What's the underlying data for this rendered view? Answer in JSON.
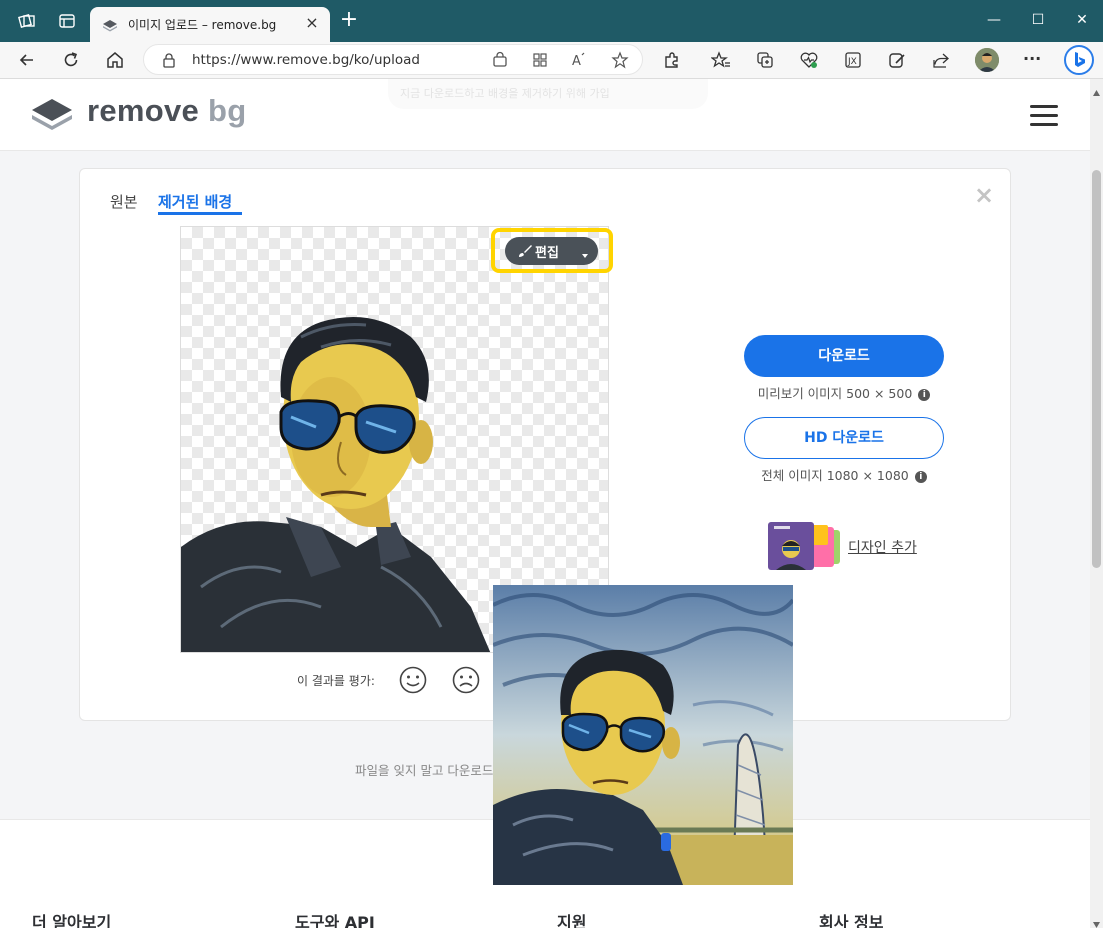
{
  "browser": {
    "tab_title": "이미지 업로드 – remove.bg",
    "tab_close": "×",
    "new_tab": "+",
    "url": "https://www.remove.bg/ko/upload",
    "window_controls": {
      "minimize": "—",
      "maximize": "☐",
      "close": "✕"
    },
    "icons": [
      "workspaces-icon",
      "tab-actions-icon",
      "back-icon",
      "refresh-icon",
      "home-icon",
      "lock-icon",
      "shopping-icon",
      "app-available-icon",
      "read-aloud-icon",
      "favorite-star-icon",
      "extensions-icon",
      "favorites-icon",
      "collections-icon",
      "browser-essentials-icon",
      "screenshot-icon",
      "edit-extension-icon",
      "share-icon",
      "profile-avatar",
      "more-icon",
      "bing-copilot-icon"
    ],
    "more": "···"
  },
  "header": {
    "logo_remove": "remove",
    "logo_bg": "bg",
    "ghost_banner": "지금 다운로드하고 배경을 제거하기 위해 가입"
  },
  "result": {
    "tab_original": "원본",
    "tab_removed": "제거된 배경",
    "close": "×",
    "edit_label": "편집",
    "rate_label": "이 결과를 평가:",
    "download": {
      "label": "다운로드",
      "sub": "미리보기 이미지 500 × 500",
      "info": "i"
    },
    "hd_download": {
      "label": "HD 다운로드",
      "sub": "전체 이미지 1080 × 1080",
      "info": "i"
    },
    "add_design": "디자인 추가",
    "hint": "파일을 잊지 말고 다운로드"
  },
  "footer": {
    "col1": "더 알아보기",
    "col2": "도구와 API",
    "col3": "지원",
    "col4": "회사 정보"
  },
  "colors": {
    "accent": "#1a73e8",
    "tabbar": "#1f5a66",
    "highlight": "#ffd400"
  }
}
